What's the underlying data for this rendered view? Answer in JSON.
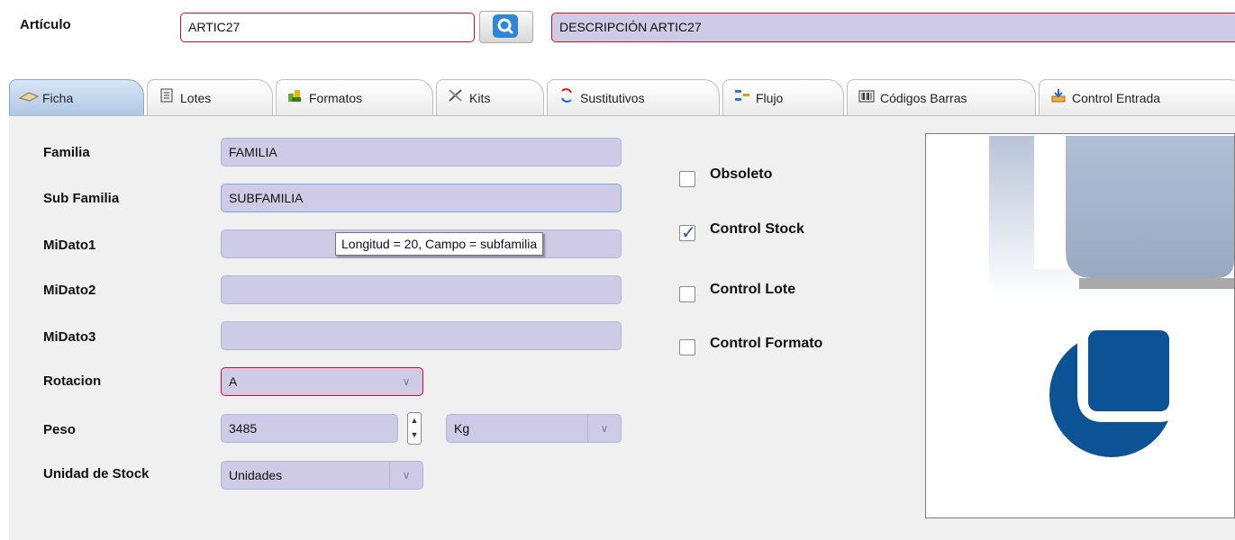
{
  "header": {
    "article_label": "Artículo",
    "article_code": "ARTIC27",
    "description": "DESCRIPCIÓN ARTIC27"
  },
  "tabs": [
    {
      "label": "Ficha",
      "icon": "sandwich-icon",
      "active": true
    },
    {
      "label": "Lotes",
      "icon": "document-icon",
      "active": false
    },
    {
      "label": "Formatos",
      "icon": "formats-icon",
      "active": false
    },
    {
      "label": "Kits",
      "icon": "tools-icon",
      "active": false
    },
    {
      "label": "Sustitutivos",
      "icon": "swap-icon",
      "active": false
    },
    {
      "label": "Flujo",
      "icon": "flow-icon",
      "active": false
    },
    {
      "label": "Códigos Barras",
      "icon": "barcode-icon",
      "active": false
    },
    {
      "label": "Control Entrada",
      "icon": "inbox-icon",
      "active": false
    }
  ],
  "form": {
    "familia": {
      "label": "Familia",
      "value": "FAMILIA"
    },
    "subfamilia": {
      "label": "Sub Familia",
      "value": "SUBFAMILIA"
    },
    "midato1": {
      "label": "MiDato1",
      "value": ""
    },
    "midato2": {
      "label": "MiDato2",
      "value": ""
    },
    "midato3": {
      "label": "MiDato3",
      "value": ""
    },
    "rotacion": {
      "label": "Rotacion",
      "value": "A"
    },
    "peso": {
      "label": "Peso",
      "value": "3485",
      "unit": "Kg"
    },
    "unidad_stock": {
      "label": "Unidad de Stock",
      "value": "Unidades"
    }
  },
  "tooltip": "Longitud = 20, Campo = subfamilia",
  "checkboxes": [
    {
      "label": "Obsoleto",
      "checked": false
    },
    {
      "label": "Control Stock",
      "checked": true
    },
    {
      "label": "Control Lote",
      "checked": false
    },
    {
      "label": "Control Formato",
      "checked": false
    }
  ],
  "colors": {
    "field_bg": "#cfcbe6",
    "required_border": "#c8102e",
    "active_tab": "#aec7e6",
    "logo_blue": "#0b5394"
  }
}
